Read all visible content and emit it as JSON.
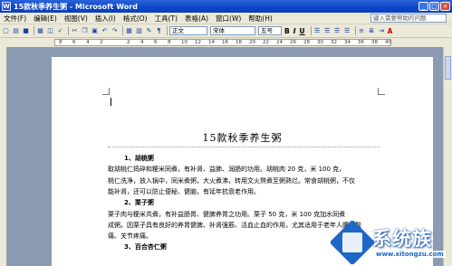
{
  "window": {
    "title": "15款秋季养生粥 - Microsoft Word",
    "minimize": "_",
    "restore": "□",
    "close": "×"
  },
  "menu": {
    "items": [
      "文件(F)",
      "编辑(E)",
      "视图(V)",
      "插入(I)",
      "格式(O)",
      "工具(T)",
      "表格(A)",
      "窗口(W)",
      "帮助(H)"
    ],
    "help_placeholder": "键入需要帮助的问题"
  },
  "toolbar": {
    "style_value": "正文",
    "font_value": "宋体",
    "size_value": "五号",
    "bold": "B",
    "italic": "I",
    "underline": "U",
    "font_color": "A"
  },
  "ruler": {
    "ticks": [
      "8",
      "6",
      "4",
      "2",
      "",
      "2",
      "4",
      "6",
      "8",
      "10",
      "12",
      "14",
      "16",
      "18",
      "20",
      "22",
      "24",
      "26",
      "28",
      "30",
      "32",
      "34",
      "36",
      "38",
      "40"
    ]
  },
  "document": {
    "title": "15款秋季养生粥",
    "lines": [
      {
        "text": "1、胡桃粥",
        "head": true
      },
      {
        "text": "取胡桃仁捣碎和粳米同煮，有补肾、益肺、润肠的功用。胡桃肉 20 克，米 100 克，",
        "head": false
      },
      {
        "text": "桃仁洗净，放入锅中，同米煮粥，大火煮沸，转用文火熬煮至粥熟烂。常食胡桃粥，不仅",
        "head": false
      },
      {
        "text": "能补肾，还可以防止便秘、健脑，有延年抗衰老作用。",
        "head": false
      },
      {
        "text": "2、栗子粥",
        "head": true
      },
      {
        "text": "栗子肉与粳米共煮，有补益肠胃、健脾养胃之功用。栗子 50 克，米 100 克加水同煮",
        "head": false
      },
      {
        "text": "成粥。因栗子具有良好的养胃健脾、补肾强筋、活血止血的作用，尤其适用于老年人腰膝酸",
        "head": false
      },
      {
        "text": "痛、关节疼痛。",
        "head": false
      },
      {
        "text": "3、百合杏仁粥",
        "head": true
      }
    ]
  },
  "watermark": {
    "brand": "系统族",
    "url": "www.xitongzu.com"
  }
}
